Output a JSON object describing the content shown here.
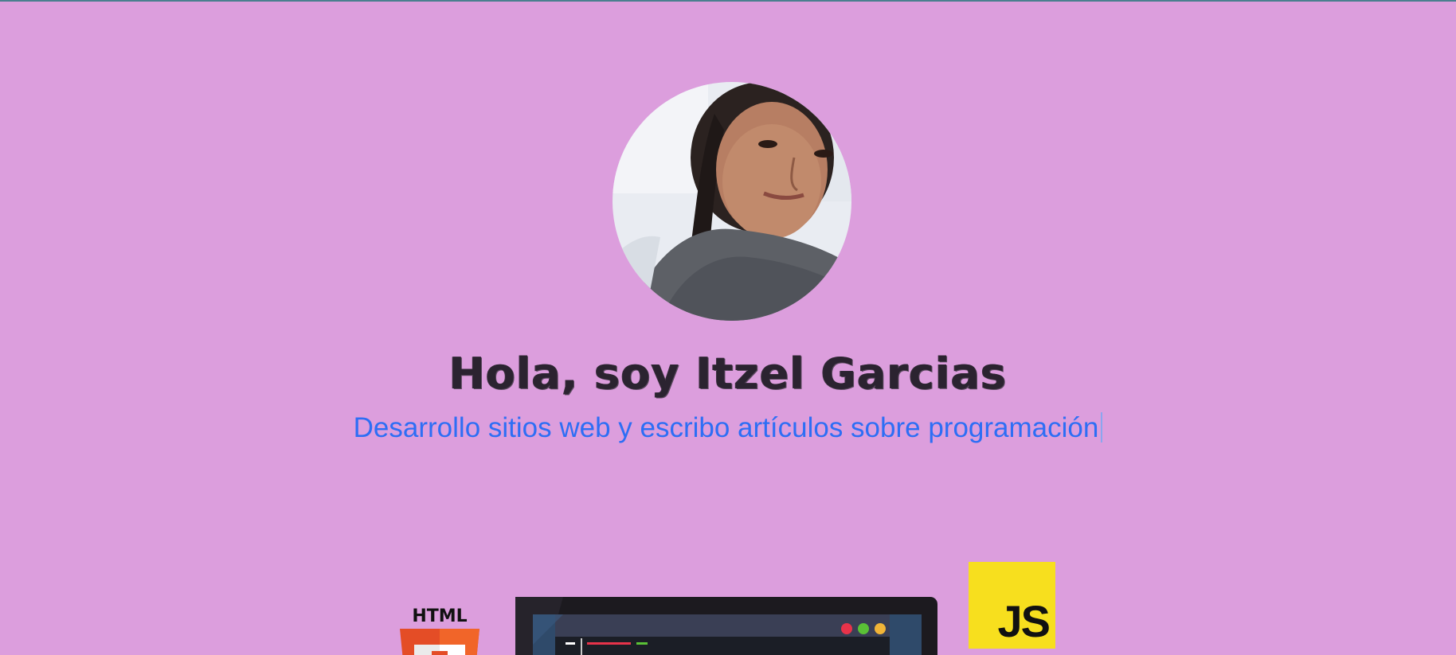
{
  "hero": {
    "title": "Hola, soy Itzel Garcias",
    "subtitle": "Desarrollo sitios web y escribo artículos sobre programación"
  },
  "profile": {
    "icon": "profile-photo"
  },
  "tech_icons": {
    "html_label": "HTML",
    "js_label": "JS",
    "laptop_icon": "code-editor-laptop-icon"
  },
  "colors": {
    "background": "#dc9edd",
    "subtitle": "#2d6ef5",
    "title": "#2b2330",
    "js_yellow": "#f7df1e",
    "html_orange": "#e44d26"
  }
}
